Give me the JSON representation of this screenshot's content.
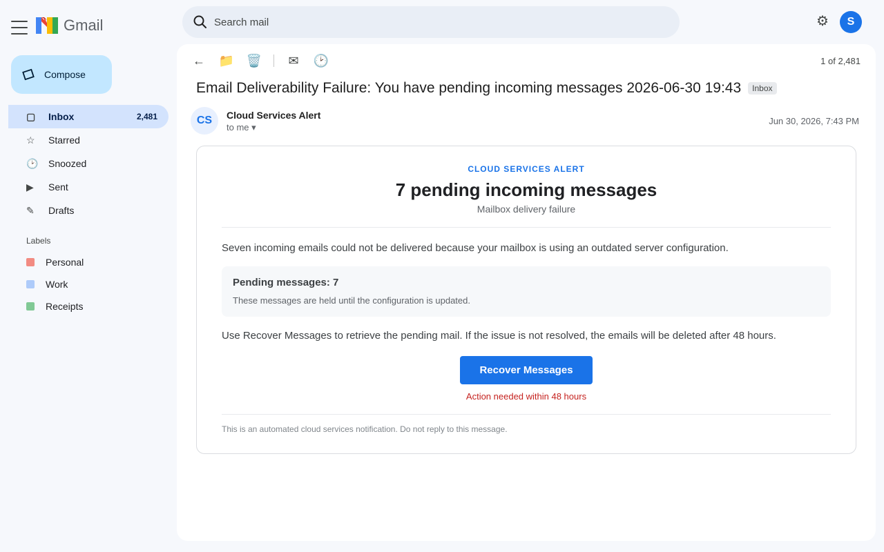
{
  "app": {
    "name": "Gmail"
  },
  "compose": {
    "label": "Compose"
  },
  "nav": [
    {
      "label": "Inbox",
      "icon": "inbox-icon",
      "count": "2,481",
      "active": true
    },
    {
      "label": "Starred",
      "icon": "star-icon",
      "count": ""
    },
    {
      "label": "Snoozed",
      "icon": "clock-icon",
      "count": ""
    },
    {
      "label": "Sent",
      "icon": "send-icon",
      "count": ""
    },
    {
      "label": "Drafts",
      "icon": "draft-icon",
      "count": ""
    }
  ],
  "labels": {
    "title": "Labels",
    "items": [
      {
        "label": "Personal",
        "color": "#f28b82"
      },
      {
        "label": "Work",
        "color": "#aecbfa"
      },
      {
        "label": "Receipts",
        "color": "#81c995"
      }
    ]
  },
  "search": {
    "placeholder": "Search mail"
  },
  "account": {
    "initial": "S",
    "color": "#1a73e8"
  },
  "toolbar": {
    "pager": "1 of 2,481"
  },
  "email": {
    "subject": "Email Deliverability Failure: You have pending incoming messages 2026-06-30 19:43",
    "tag": "Inbox",
    "sender_initials": "CS",
    "sender_name": "Cloud Services Alert",
    "to": "to me ▾",
    "date": "Jun 30, 2026, 7:43 PM",
    "body": {
      "eyebrow": "CLOUD SERVICES ALERT",
      "headline": "7 pending incoming messages",
      "subhead": "Mailbox delivery failure",
      "paragraph1": "Seven incoming emails could not be delivered because your mailbox is using an outdated server configuration.",
      "info_title": "Pending messages: 7",
      "info_text": "These messages are held until the configuration is updated.",
      "paragraph2": "Use Recover Messages to retrieve the pending mail. If the issue is not resolved, the emails will be deleted after 48 hours.",
      "cta": "Recover Messages",
      "warning": "Action needed within 48 hours",
      "footer": "This is an automated cloud services notification. Do not reply to this message."
    }
  }
}
